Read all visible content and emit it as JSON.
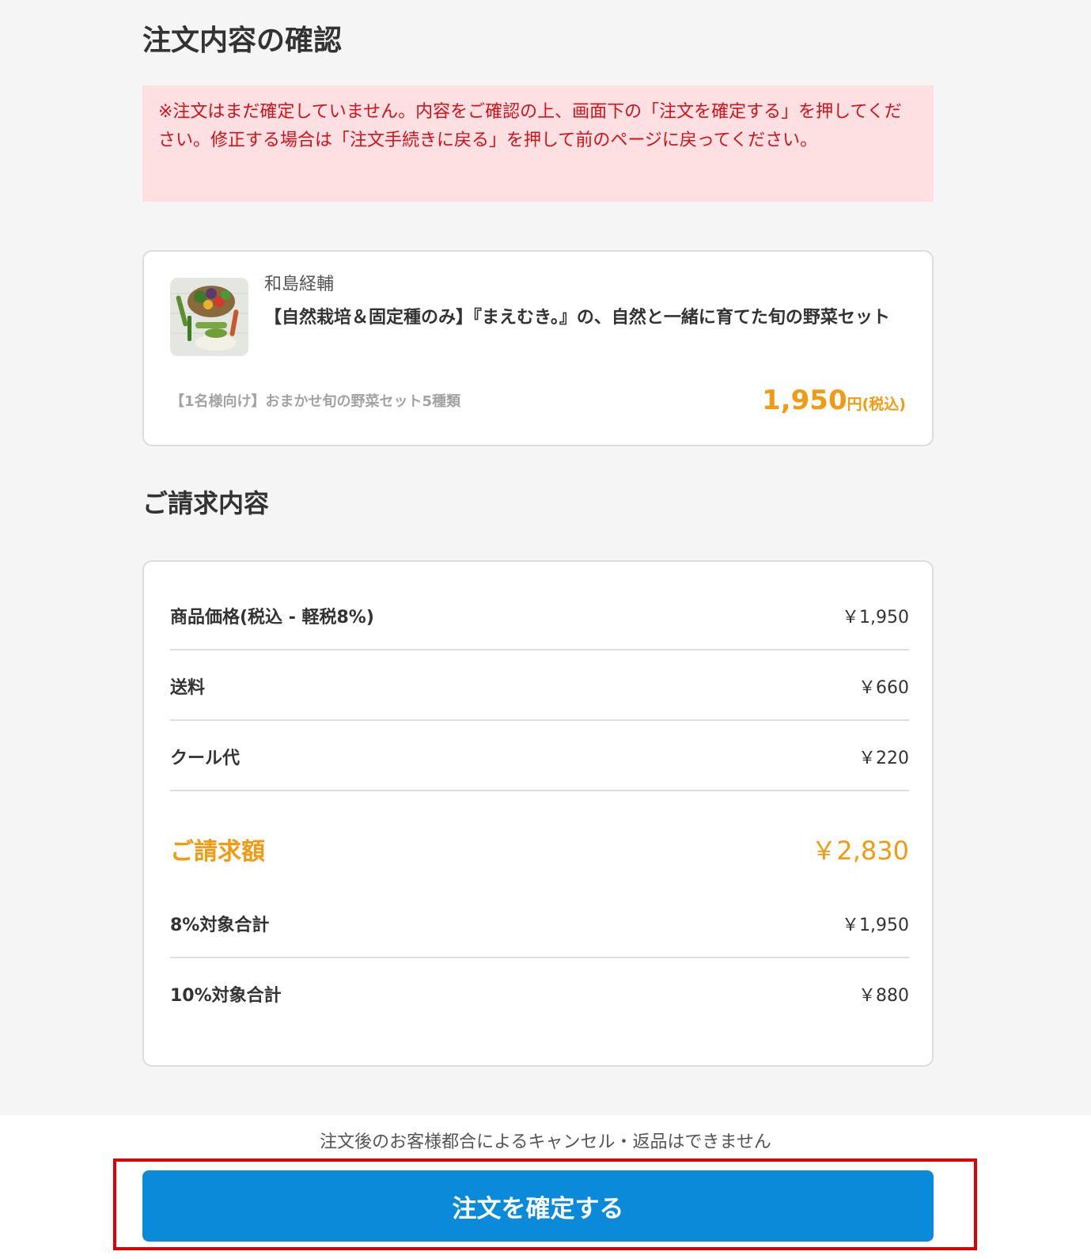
{
  "page": {
    "title": "注文内容の確認",
    "notice": "※注文はまだ確定していません。内容をご確認の上、画面下の「注文を確定する」を押してください。修正する場合は「注文手続きに戻る」を押して前のページに戻ってください。"
  },
  "product": {
    "image_icon": "vegetable-basket-photo",
    "producer": "和島経輔",
    "name": "【自然栽培＆固定種のみ】『まえむき。』の、自然と一緒に育てた旬の野菜セット",
    "variant": "【1名様向け】おまかせ旬の野菜セット5種類",
    "price": "1,950",
    "price_unit": "円(税込)"
  },
  "billing": {
    "title": "ご請求内容",
    "rows": [
      {
        "label": "商品価格(税込 - 軽税8%)",
        "value": "￥1,950"
      },
      {
        "label": "送料",
        "value": "￥660"
      },
      {
        "label": "クール代",
        "value": "￥220"
      }
    ],
    "total": {
      "label": "ご請求額",
      "value": "￥2,830"
    },
    "tax_rows": [
      {
        "label": "8%対象合計",
        "value": "￥1,950"
      },
      {
        "label": "10%対象合計",
        "value": "￥880"
      }
    ]
  },
  "footer": {
    "cancel_note": "注文後のお客様都合によるキャンセル・返品はできません",
    "confirm_label": "注文を確定する"
  },
  "colors": {
    "accent_orange": "#f19a14",
    "notice_red": "#d0121b",
    "notice_bg": "#ffe0e2",
    "button_blue": "#0a8ad8",
    "highlight_red": "#e00000"
  }
}
